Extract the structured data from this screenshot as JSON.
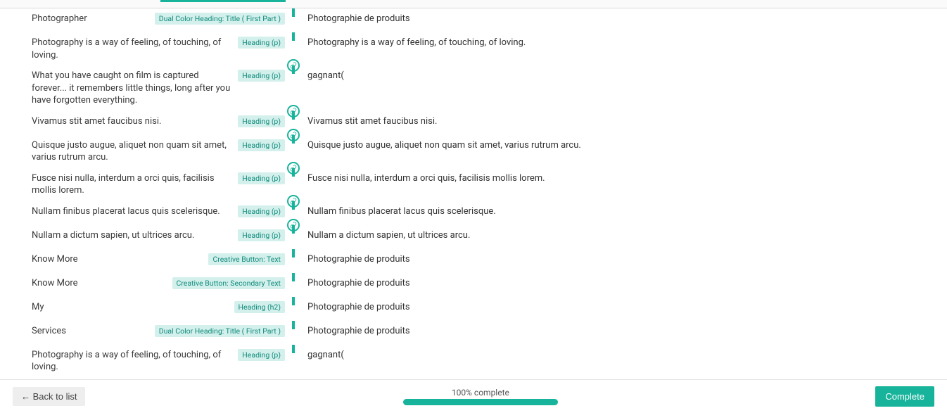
{
  "rows": [
    {
      "left": "Photographer",
      "badge": "Dual Color Heading: Title ( First Part )",
      "right": "Photographie de produits",
      "link_after": false
    },
    {
      "left": "Photography is a way of feeling, of touching, of loving.",
      "badge": "Heading (p)",
      "right": "Photography is a way of feeling, of touching, of loving.",
      "link_after": true
    },
    {
      "left": "What you have caught on film is captured forever... it remembers little things, long after you have forgotten everything.",
      "badge": "Heading (p)",
      "right": "gagnant(",
      "link_after": true
    },
    {
      "left": "Vivamus stit amet faucibus nisi.",
      "badge": "Heading (p)",
      "right": "Vivamus stit amet faucibus nisi.",
      "link_after": true
    },
    {
      "left": "Quisque justo augue, aliquet non quam sit amet, varius rutrum arcu.",
      "badge": "Heading (p)",
      "right": "Quisque justo augue, aliquet non quam sit amet, varius rutrum arcu.",
      "link_after": true
    },
    {
      "left": "Fusce nisi nulla, interdum a orci quis, facilisis mollis lorem.",
      "badge": "Heading (p)",
      "right": "Fusce nisi nulla, interdum a orci quis, facilisis mollis lorem.",
      "link_after": true
    },
    {
      "left": "Nullam finibus placerat lacus quis scelerisque.",
      "badge": "Heading (p)",
      "right": "Nullam finibus placerat lacus quis scelerisque.",
      "link_after": true
    },
    {
      "left": "Nullam a dictum sapien, ut ultrices arcu.",
      "badge": "Heading (p)",
      "right": "Nullam a dictum sapien, ut ultrices arcu.",
      "link_after": false
    },
    {
      "left": "Know More",
      "badge": "Creative Button: Text",
      "right": "Photographie de produits",
      "link_after": false
    },
    {
      "left": "Know More",
      "badge": "Creative Button: Secondary Text",
      "right": "Photographie de produits",
      "link_after": false
    },
    {
      "left": "My",
      "badge": "Heading (h2)",
      "right": "Photographie de produits",
      "link_after": false
    },
    {
      "left": "Services",
      "badge": "Dual Color Heading: Title ( First Part )",
      "right": "Photographie de produits",
      "link_after": false
    },
    {
      "left": "Photography is a way of feeling, of touching, of loving.",
      "badge": "Heading (p)",
      "right": "gagnant(",
      "link_after": false
    }
  ],
  "footer": {
    "back": "← Back to list",
    "progress_label": "100% complete",
    "complete": "Complete"
  }
}
